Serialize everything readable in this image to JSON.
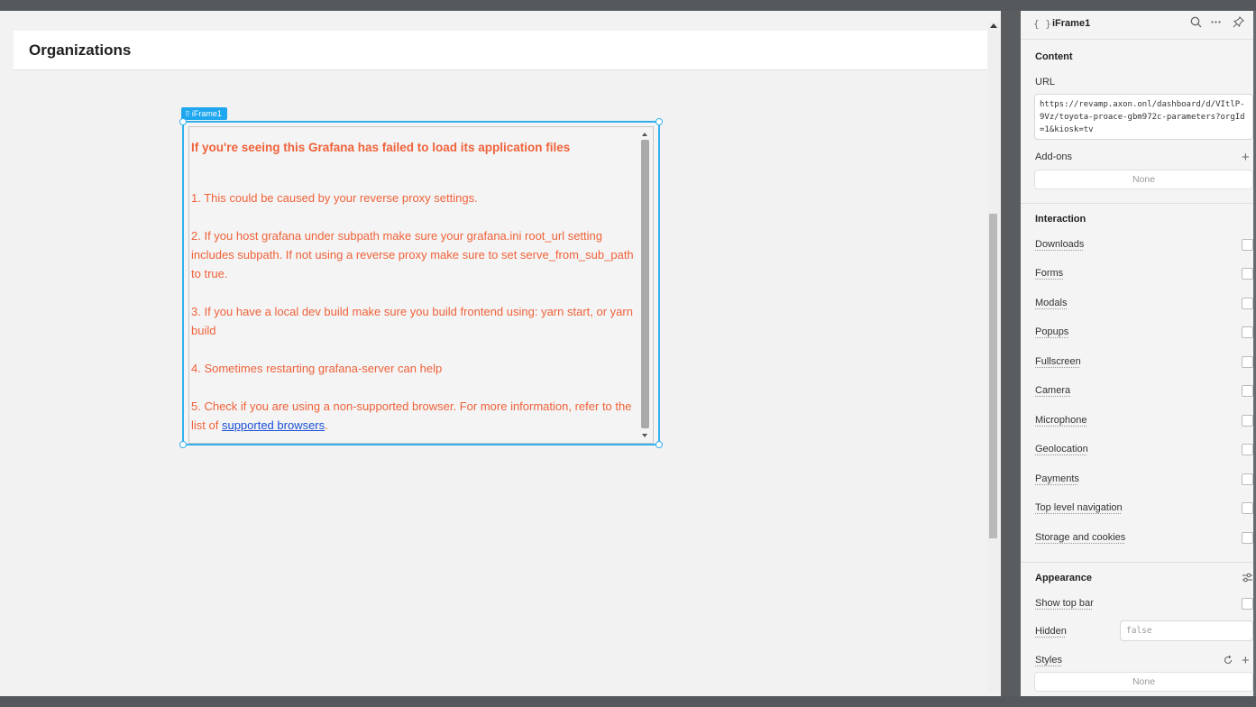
{
  "canvas": {
    "page_title": "Organizations",
    "component_tag": "iFrame1",
    "iframe": {
      "error_title": "If you're seeing this Grafana has failed to load its application files",
      "items": [
        "1. This could be caused by your reverse proxy settings.",
        "2. If you host grafana under subpath make sure your grafana.ini root_url setting includes subpath. If not using a reverse proxy make sure to set serve_from_sub_path to true.",
        "3. If you have a local dev build make sure you build frontend using: yarn start, or yarn build",
        "4. Sometimes restarting grafana-server can help"
      ],
      "item5_prefix": "5. Check if you are using a non-supported browser. For more information, refer to the list of ",
      "item5_link": "supported browsers",
      "item5_suffix": "."
    }
  },
  "panel": {
    "braces": "{ }",
    "component_name": "iFrame1",
    "icons": [
      "search-icon",
      "more-icon",
      "pin-icon"
    ],
    "content": {
      "title": "Content",
      "url_label": "URL",
      "url_value": "https://revamp.axon.onl/dashboard/d/VItlP-9Vz/toyota-proace-gbm972c-parameters?orgId=1&kiosk=tv",
      "addons_label": "Add-ons",
      "addons_value": "None"
    },
    "interaction": {
      "title": "Interaction",
      "items": [
        "Downloads",
        "Forms",
        "Modals",
        "Popups",
        "Fullscreen",
        "Camera",
        "Microphone",
        "Geolocation",
        "Payments",
        "Top level navigation",
        "Storage and cookies"
      ]
    },
    "appearance": {
      "title": "Appearance",
      "show_top_bar": "Show top bar",
      "hidden_label": "Hidden",
      "hidden_value": "false",
      "styles_label": "Styles",
      "styles_value": "None"
    }
  }
}
